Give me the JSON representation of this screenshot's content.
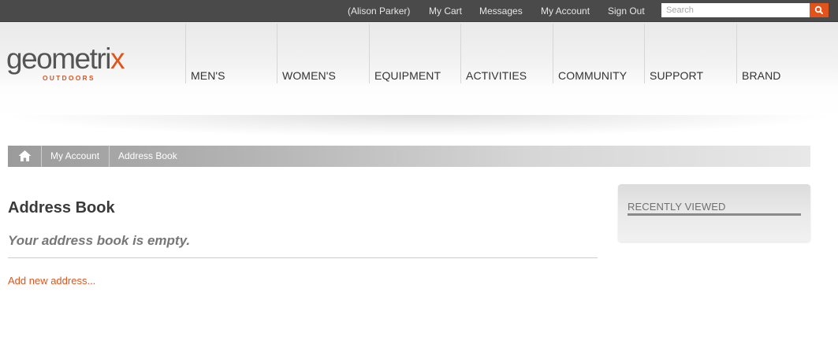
{
  "topbar": {
    "user": "(Alison Parker)",
    "cart": "My Cart",
    "messages": "Messages",
    "account": "My Account",
    "signout": "Sign Out",
    "search_placeholder": "Search"
  },
  "logo": {
    "main": "geometri",
    "x": "x",
    "sub": "OUTDOORS"
  },
  "nav": [
    "MEN'S",
    "WOMEN'S",
    "EQUIPMENT",
    "ACTIVITIES",
    "COMMUNITY",
    "SUPPORT",
    "BRAND"
  ],
  "breadcrumb": [
    "My Account",
    "Address Book"
  ],
  "main": {
    "title": "Address Book",
    "empty_message": "Your address book is empty.",
    "add_link": "Add new address..."
  },
  "sidebar": {
    "recently_viewed": "RECENTLY VIEWED"
  },
  "colors": {
    "accent": "#e2531c",
    "topbar": "#4a4a4a"
  },
  "icons": {
    "home": "home-icon",
    "search": "search-icon"
  }
}
